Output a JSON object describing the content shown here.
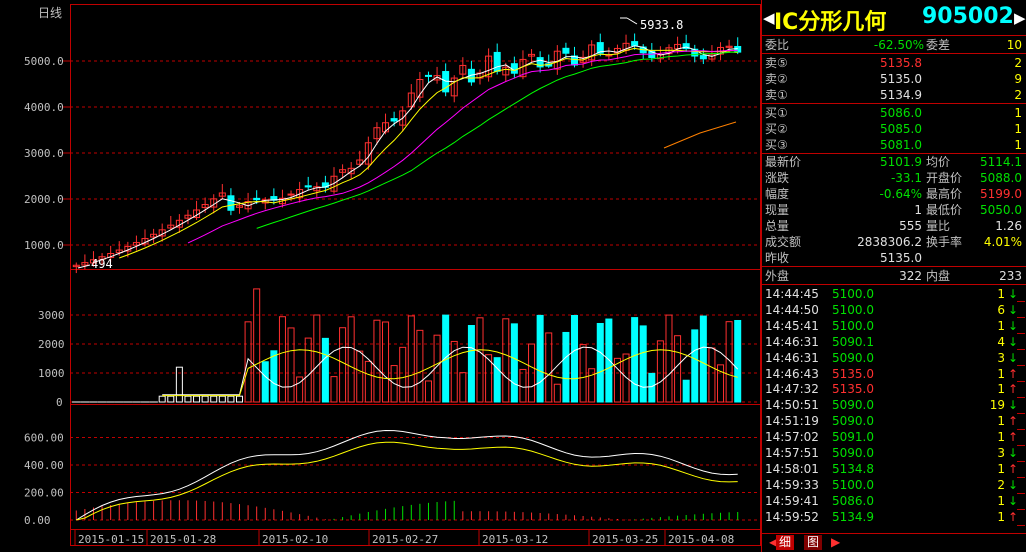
{
  "chart": {
    "period_label": "日线",
    "price_axis": [
      "5000.0",
      "4000.0",
      "3000.0",
      "2000.0",
      "1000.0"
    ],
    "vol_axis": [
      "3000",
      "2000",
      "1000",
      "0"
    ],
    "ind_axis": [
      "600.00",
      "400.00",
      "200.00",
      "0.00"
    ],
    "date_labels": [
      "2015-01-15",
      "2015-01-28",
      "2015-02-10",
      "2015-02-27",
      "2015-03-12",
      "2015-03-25",
      "2015-04-08"
    ],
    "high_marker": "5933.8",
    "low_marker": "494",
    "colors": {
      "up": "#ff3030",
      "down": "#00ffff",
      "ma1": "#ffffff",
      "ma2": "#ffff00",
      "ma3": "#ff00ff",
      "ma4": "#00ff00",
      "ma5": "#ff8000",
      "grid": "#c00000"
    }
  },
  "quote": {
    "name": "IC分形几何",
    "code": "905002",
    "weibi_label": "委比",
    "weibi_value": "-62.50%",
    "weicha_label": "委差",
    "weicha_value": "10",
    "asks": [
      {
        "label": "卖⑤",
        "price": "5135.8",
        "vol": "2"
      },
      {
        "label": "卖②",
        "price": "5135.0",
        "vol": "9"
      },
      {
        "label": "卖①",
        "price": "5134.9",
        "vol": "2"
      }
    ],
    "bids": [
      {
        "label": "买①",
        "price": "5086.0",
        "vol": "1"
      },
      {
        "label": "买②",
        "price": "5085.0",
        "vol": "1"
      },
      {
        "label": "买③",
        "price": "5081.0",
        "vol": "1"
      }
    ],
    "stats": [
      {
        "l1": "最新价",
        "v1": "5101.9",
        "l2": "均价",
        "v2": "5114.1",
        "c1": "dn",
        "c2": "dn"
      },
      {
        "l1": "涨跌",
        "v1": "-33.1",
        "l2": "开盘价",
        "v2": "5088.0",
        "c1": "dn",
        "c2": "dn"
      },
      {
        "l1": "幅度",
        "v1": "-0.64%",
        "l2": "最高价",
        "v2": "5199.0",
        "c1": "dn",
        "c2": "up"
      },
      {
        "l1": "现量",
        "v1": "1",
        "l2": "最低价",
        "v2": "5050.0",
        "c1": "wh",
        "c2": "dn"
      },
      {
        "l1": "总量",
        "v1": "555",
        "l2": "量比",
        "v2": "1.26",
        "c1": "wh",
        "c2": "wh"
      },
      {
        "l1": "成交额",
        "v1": "2838306.2",
        "l2": "换手率",
        "v2": "4.01%",
        "c1": "wh",
        "c2": "yl"
      },
      {
        "l1": "昨收",
        "v1": "5135.0",
        "l2": "",
        "v2": "",
        "c1": "wh",
        "c2": "wh"
      }
    ],
    "outer_label": "外盘",
    "outer_value": "322",
    "inner_label": "内盘",
    "inner_value": "233",
    "ticks": [
      {
        "time": "14:44:45",
        "price": "5100.0",
        "vol": "1",
        "dir": "down"
      },
      {
        "time": "14:44:50",
        "price": "5100.0",
        "vol": "6",
        "dir": "down"
      },
      {
        "time": "14:45:41",
        "price": "5100.0",
        "vol": "1",
        "dir": "down"
      },
      {
        "time": "14:46:31",
        "price": "5090.1",
        "vol": "4",
        "dir": "down"
      },
      {
        "time": "14:46:31",
        "price": "5090.0",
        "vol": "3",
        "dir": "down"
      },
      {
        "time": "14:46:43",
        "price": "5135.0",
        "vol": "1",
        "dir": "up"
      },
      {
        "time": "14:47:32",
        "price": "5135.0",
        "vol": "1",
        "dir": "up"
      },
      {
        "time": "14:50:51",
        "price": "5090.0",
        "vol": "19",
        "dir": "down"
      },
      {
        "time": "14:51:19",
        "price": "5090.0",
        "vol": "1",
        "dir": "up"
      },
      {
        "time": "14:57:02",
        "price": "5091.0",
        "vol": "1",
        "dir": "up"
      },
      {
        "time": "14:57:51",
        "price": "5090.0",
        "vol": "3",
        "dir": "down"
      },
      {
        "time": "14:58:01",
        "price": "5134.8",
        "vol": "1",
        "dir": "up"
      },
      {
        "time": "14:59:33",
        "price": "5100.0",
        "vol": "2",
        "dir": "down"
      },
      {
        "time": "14:59:41",
        "price": "5086.0",
        "vol": "1",
        "dir": "down"
      },
      {
        "time": "14:59:52",
        "price": "5134.9",
        "vol": "1",
        "dir": "up"
      }
    ],
    "tabs": [
      "细",
      "图"
    ]
  }
}
